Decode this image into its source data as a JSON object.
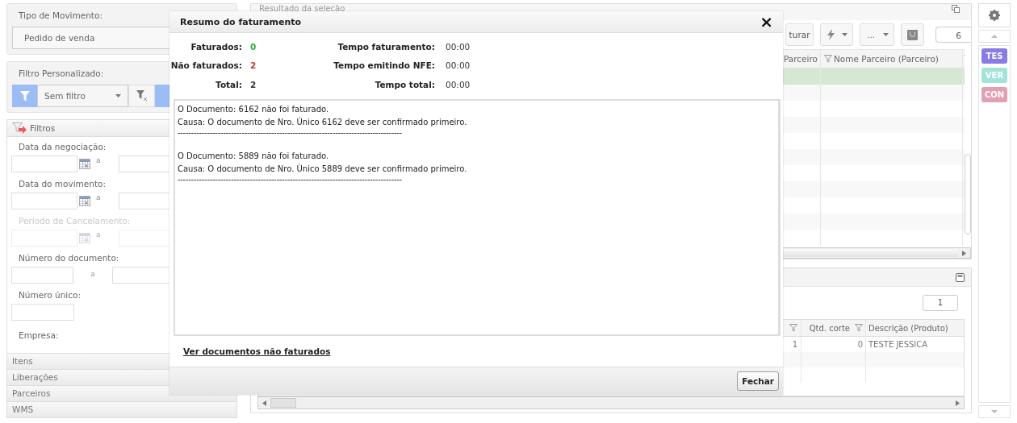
{
  "filters_panel": {
    "movement_type": {
      "label": "Tipo de Movimento:",
      "value": "Pedido de venda"
    },
    "custom_filter": {
      "label": "Filtro Personalizado:",
      "value": "Sem filtro"
    },
    "filters": {
      "title": "Filtros",
      "fields": [
        {
          "kind": "date-range",
          "label": "Data da negociação:",
          "separator": "a",
          "disabled": false
        },
        {
          "kind": "date-range",
          "label": "Data do movimento:",
          "separator": "a",
          "disabled": false
        },
        {
          "kind": "date-range",
          "label": "Período de Cancelamento:",
          "separator": "a",
          "disabled": true
        },
        {
          "kind": "range",
          "label": "Número do documento:",
          "separator": "a",
          "disabled": false
        },
        {
          "kind": "single",
          "label": "Número único:",
          "disabled": false
        },
        {
          "kind": "label-only",
          "label": "Empresa:",
          "disabled": false
        }
      ]
    },
    "sections": [
      {
        "label": "Itens"
      },
      {
        "label": "Liberações"
      },
      {
        "label": "Parceiros"
      },
      {
        "label": "WMS"
      }
    ]
  },
  "results": {
    "title": "Resultado da seleção",
    "toolbar": {
      "action_label": "turar",
      "more_label": "...",
      "page": "6"
    },
    "columns": [
      "Parceiro",
      "Nome Parceiro (Parceiro)"
    ],
    "rows": [
      {
        "selected": true
      },
      {
        "selected": false
      },
      {
        "selected": false
      },
      {
        "selected": false
      },
      {
        "selected": false
      },
      {
        "selected": false
      },
      {
        "selected": false
      },
      {
        "selected": false
      },
      {
        "selected": false
      },
      {
        "selected": false
      },
      {
        "selected": false
      }
    ]
  },
  "items": {
    "page": "1",
    "columns": [
      "",
      "Qtd. corte",
      "Descrição (Produto)"
    ],
    "rows": [
      {
        "cells": [
          "1",
          "0",
          "TESTE JESSICA"
        ]
      }
    ]
  },
  "sidebar": {
    "badges": [
      {
        "label": "TES",
        "color": "#8a7be2"
      },
      {
        "label": "VER",
        "color": "#a3e3d8"
      },
      {
        "label": "CON",
        "color": "#e3a0b2"
      }
    ]
  },
  "dialog": {
    "title": "Resumo do faturamento",
    "close_label": "×",
    "stats": [
      {
        "label": "Faturados:",
        "value": "0",
        "color": "#2eaa2e"
      },
      {
        "label": "Não faturados:",
        "value": "2",
        "color": "#c0392b"
      },
      {
        "label": "Total:",
        "value": "2",
        "color": "#333333"
      }
    ],
    "times": [
      {
        "label": "Tempo faturamento:",
        "value": "00:00"
      },
      {
        "label": "Tempo emitindo NFE:",
        "value": "00:00"
      },
      {
        "label": "Tempo total:",
        "value": "00:00"
      }
    ],
    "log": [
      {
        "message": "O Documento: 6162 não foi faturado.",
        "cause": "Causa: O documento de Nro. Único 6162 deve ser confirmado primeiro.",
        "separator": "------------------------------------------------------------------------------------"
      },
      {
        "message": "O Documento: 5889 não foi faturado.",
        "cause": "Causa: O documento de Nro. Único 5889 deve ser confirmado primeiro.",
        "separator": "------------------------------------------------------------------------------------"
      }
    ],
    "link": "Ver documentos não faturados",
    "close_button": "Fechar"
  }
}
